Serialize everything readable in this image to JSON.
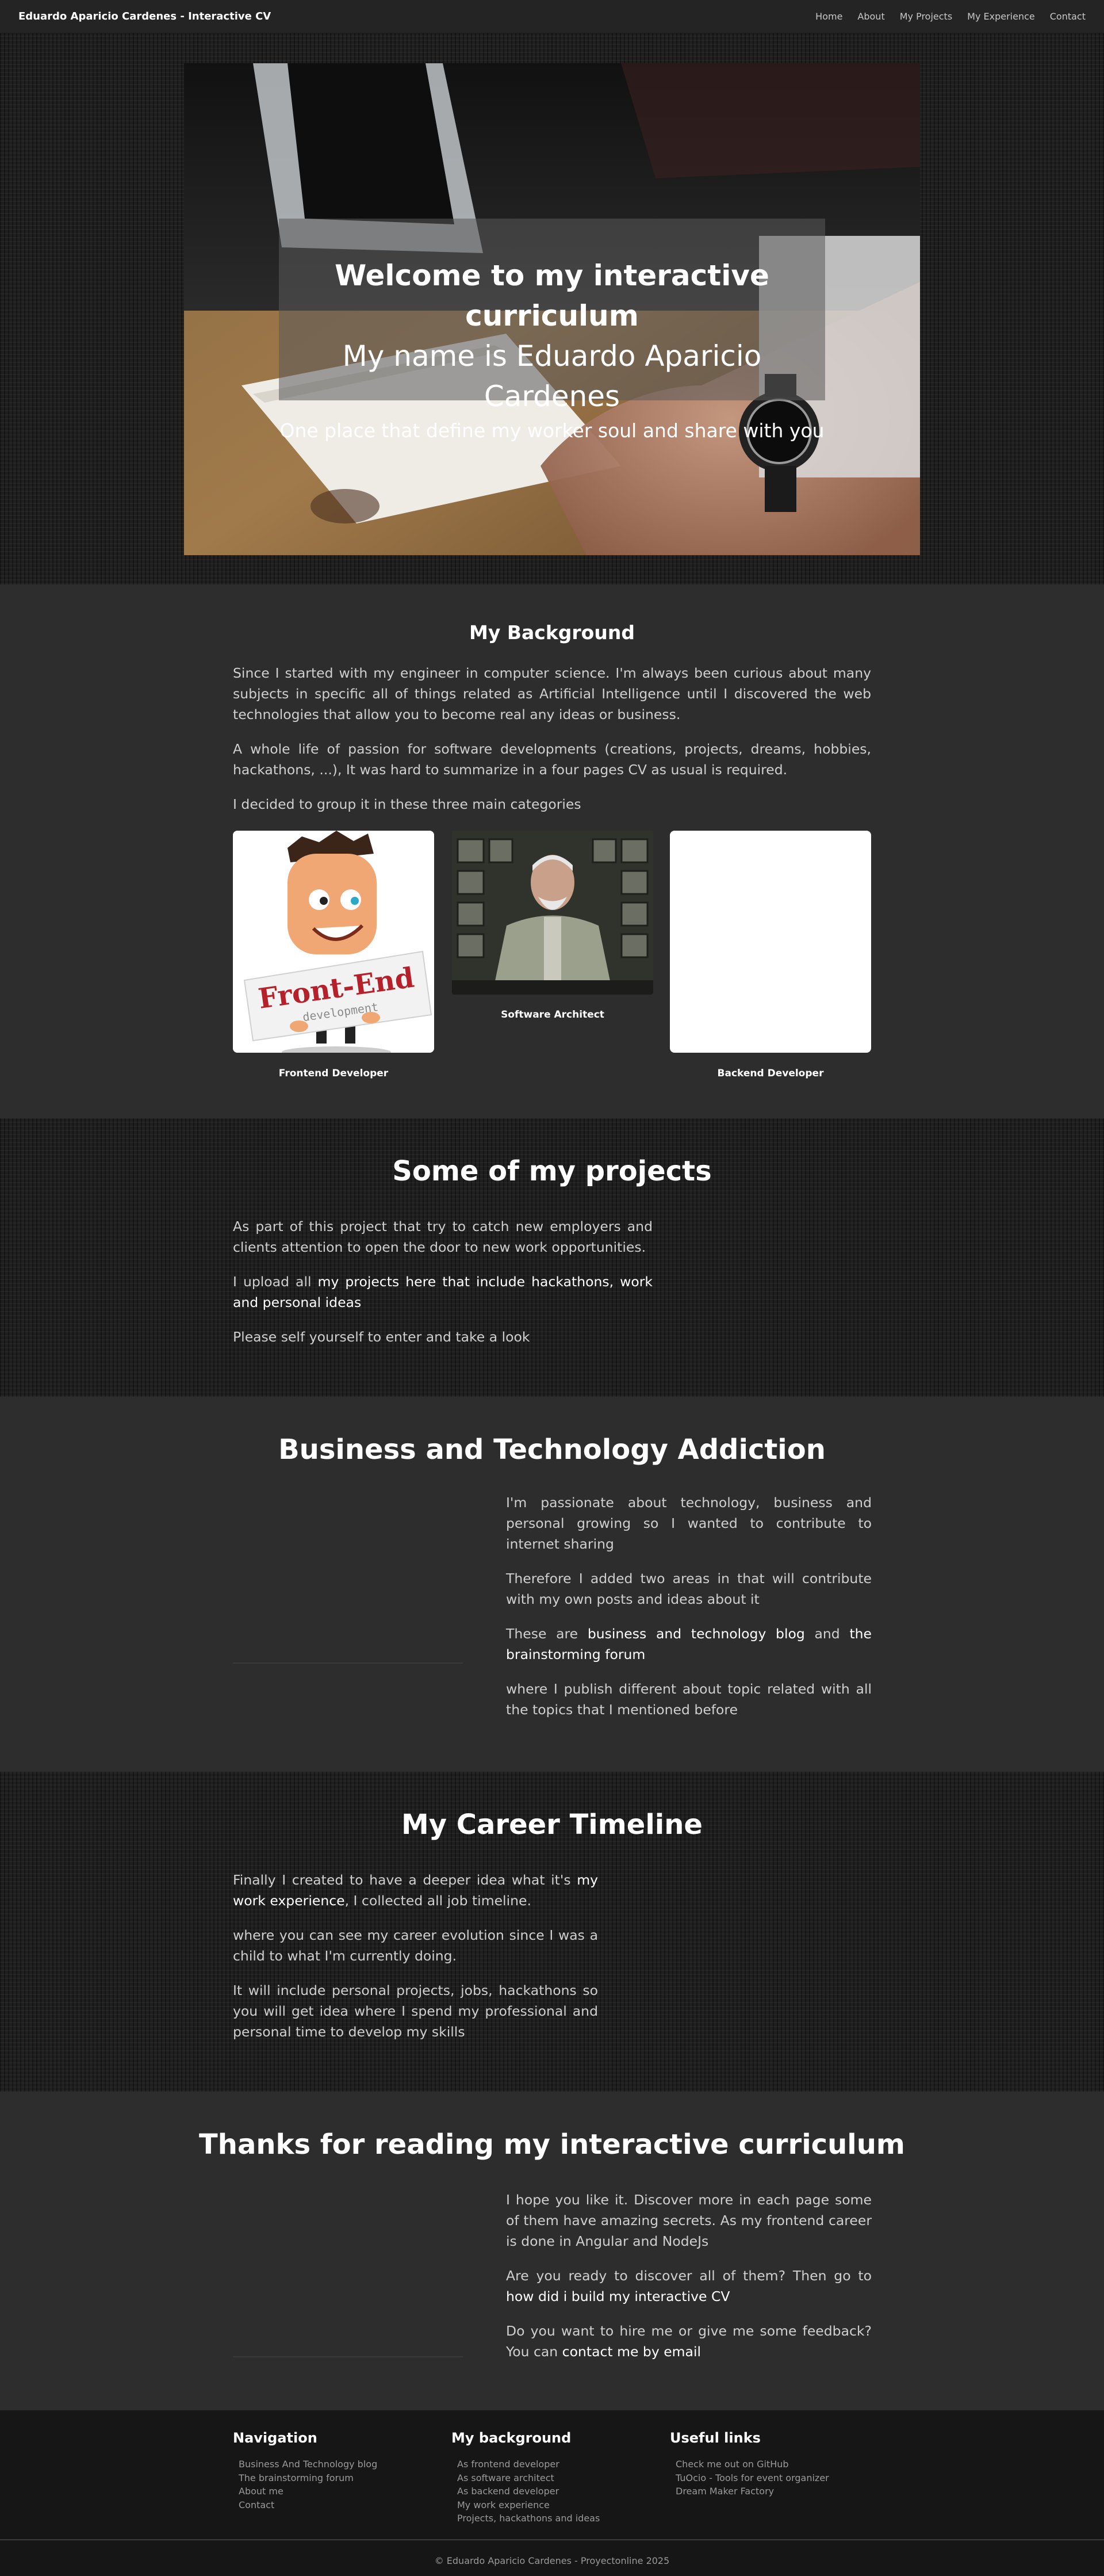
{
  "nav": {
    "brand": "Eduardo Aparicio Cardenes - Interactive CV",
    "links": [
      "Home",
      "About",
      "My Projects",
      "My Experience",
      "Contact"
    ]
  },
  "hero": {
    "line1": "Welcome to my interactive curriculum",
    "line2": "My name is Eduardo Aparicio Cardenes",
    "line3": "One place that define my worker soul and share with you"
  },
  "background": {
    "title": "My Background",
    "p1": "Since I started with my engineer in computer science. I'm always been curious about many subjects in specific all of things related as Artificial Intelligence until I discovered the web technologies that allow you to become real any ideas or business.",
    "p2": "A whole life of passion for software developments (creations, projects, dreams, hobbies, hackathons, ...), It was hard to summarize in a four pages CV as usual is required.",
    "p3": "I decided to group it in these three main categories",
    "cards": [
      {
        "label": "Frontend Developer",
        "image_text": "Front-End",
        "image_subtext": "development"
      },
      {
        "label": "Software Architect"
      },
      {
        "label": "Backend Developer"
      }
    ]
  },
  "projects": {
    "title": "Some of my projects",
    "p1": "As part of this project that try to catch new employers and clients attention to open the door to new work opportunities.",
    "p2_prefix": "I upload all ",
    "p2_link": "my projects here that include hackathons, work and personal ideas",
    "p3": "Please self yourself to enter and take a look"
  },
  "business": {
    "title": "Business and Technology Addiction",
    "p1": "I'm passionate about technology, business and personal growing so I wanted to contribute to internet sharing",
    "p2": "Therefore I added two areas in that will contribute with my own posts and ideas about it",
    "p3_prefix": "These are ",
    "p3_link1": "business and technology blog",
    "p3_mid": " and ",
    "p3_link2": "the brainstorming forum",
    "p4": "where I publish different about topic related with all the topics that I mentioned before"
  },
  "career": {
    "title": "My Career Timeline",
    "p1_prefix": "Finally I created to have a deeper idea what it's ",
    "p1_link": "my work experience",
    "p1_suffix": ", I collected all job timeline.",
    "p2": "where you can see my career evolution since I was a child to what I'm currently doing.",
    "p3": "It will include personal projects, jobs, hackathons so you will get idea where I spend my professional and personal time to develop my skills"
  },
  "thanks": {
    "title": "Thanks for reading my interactive curriculum",
    "p1": "I hope you like it. Discover more in each page some of them have amazing secrets. As my frontend career is done in Angular and NodeJs",
    "p2_prefix": "Are you ready to discover all of them? Then go to ",
    "p2_link": "how did i build my interactive CV",
    "p3_prefix": "Do you want to hire me or give me some feedback? You can ",
    "p3_link": "contact me by email"
  },
  "footer": {
    "navigation": {
      "title": "Navigation",
      "items": [
        "Business And Technology blog",
        "The brainstorming forum",
        "About me",
        "Contact"
      ]
    },
    "background": {
      "title": "My background",
      "items": [
        "As frontend developer",
        "As software architect",
        "As backend developer",
        "My work experience",
        "Projects, hackathons and ideas"
      ]
    },
    "useful": {
      "title": "Useful links",
      "items": [
        "Check me out on GitHub",
        "TuOcio - Tools for event organizer",
        "Dream Maker Factory"
      ]
    },
    "copyright": "© Eduardo Aparicio Cardenes - Proyectonline 2025"
  },
  "colors": {
    "navbar_bg": "#242424",
    "section_bg": "#2d2d2d",
    "pattern_bg": "#1f1f1f",
    "footer_bg": "#161616",
    "text": "#cfcfcf",
    "heading": "#ffffff"
  }
}
